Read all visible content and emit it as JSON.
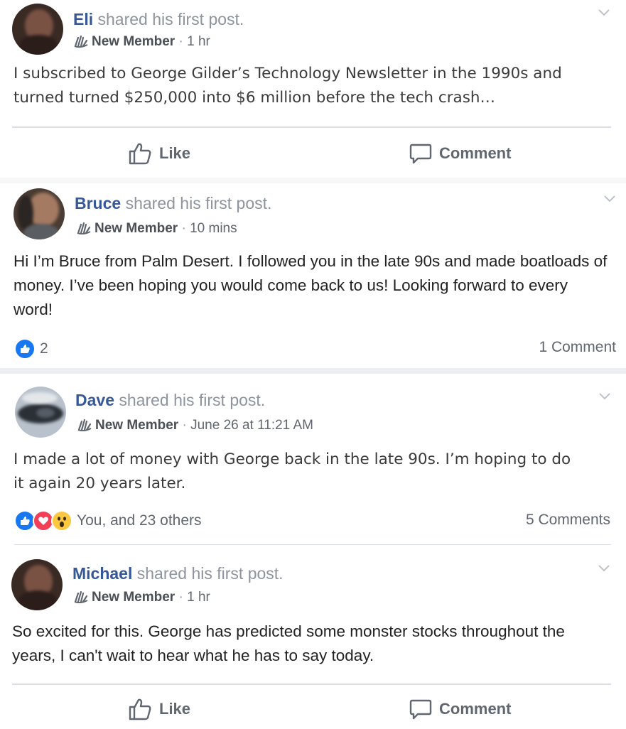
{
  "posts": [
    {
      "author": "Eli",
      "action_text": "shared his first post.",
      "badge": "New Member",
      "separator": "·",
      "time": "1 hr",
      "text": "I subscribed to George Gilder’s Technology Newsletter in the 1990s and turned turned $250,000 into $6 million before the tech crash…",
      "like_label": "Like",
      "comment_label": "Comment"
    },
    {
      "author": "Bruce",
      "action_text": "shared his first post.",
      "badge": "New Member",
      "separator": "·",
      "time": "10 mins",
      "text": "Hi I’m Bruce from Palm Desert. I followed you in the late 90s and made boatloads of money. I’ve been hoping you would come back to us! Looking forward to every word!",
      "reaction_count": "2",
      "comments_count": "1 Comment"
    },
    {
      "author": "Dave",
      "action_text": "shared his first post.",
      "badge": "New Member",
      "separator": "·",
      "time": "June 26 at 11:21 AM",
      "text": "I made a lot of money with George back in the late 90s. I’m hoping to do it again 20 years later.",
      "reaction_text": "You, and 23 others",
      "comments_count": "5 Comments"
    },
    {
      "author": "Michael",
      "action_text": "shared his first post.",
      "badge": "New Member",
      "separator": "·",
      "time": "1 hr",
      "text": "So excited for this. George has predicted some monster stocks throughout the years, I can't wait to hear what he has to say today.",
      "like_label": "Like",
      "comment_label": "Comment"
    }
  ],
  "colors": {
    "name": "#365899",
    "like_blue": "#1877f2",
    "love_red": "#f33e58",
    "wow_yellow": "#fcc83f",
    "divider": "#dadde1"
  },
  "icons": [
    "chevron-down-icon",
    "wave-icon",
    "thumbs-up-icon",
    "comment-icon",
    "like-reaction-icon",
    "love-reaction-icon",
    "wow-reaction-icon"
  ]
}
